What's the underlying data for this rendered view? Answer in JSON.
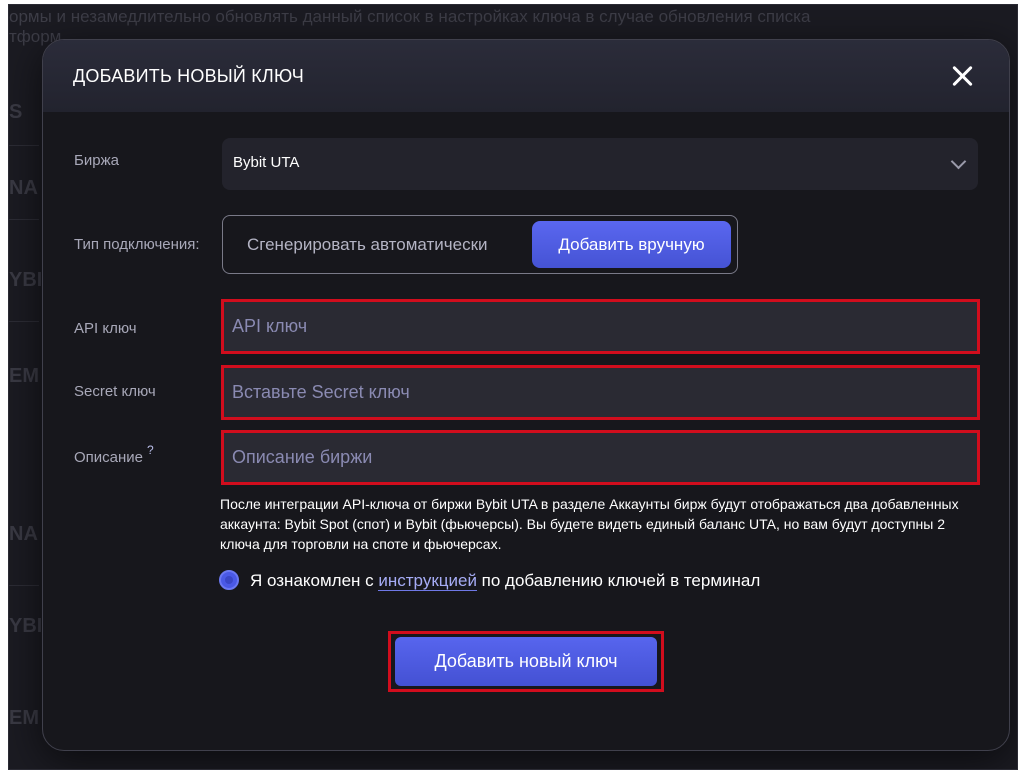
{
  "background": {
    "top_text_line1": "ормы и незамедлительно обновлять данный список в настройках ключа в случае обновления списка",
    "top_text_line2": "тформ",
    "side_labels": [
      "S",
      "NA",
      "YBI",
      "EM",
      "NA",
      "YBI",
      "EM"
    ]
  },
  "modal": {
    "title": "ДОБАВИТЬ НОВЫЙ КЛЮЧ",
    "close_icon": "close-icon"
  },
  "exchange": {
    "label": "Биржа",
    "selected": "Bybit UTA",
    "chevron_icon": "chevron-down-icon"
  },
  "connection_type": {
    "label": "Тип подключения:",
    "options": [
      "Сгенерировать автоматически",
      "Добавить вручную"
    ],
    "selected": "Добавить вручную"
  },
  "api_key": {
    "label": "API ключ",
    "value": "",
    "placeholder": "API ключ"
  },
  "secret_key": {
    "label": "Secret ключ",
    "value": "",
    "placeholder": "Вставьте Secret ключ"
  },
  "description": {
    "label": "Описание",
    "help_mark": "?",
    "value": "",
    "placeholder": "Описание биржи"
  },
  "info_text": "После интеграции API-ключа от биржи Bybit UTA в разделе Аккаунты бирж будут отображаться два добавленных аккаунта: Bybit Spot (спот) и Bybit (фьючерсы). Вы будете видеть единый баланс UTA, но вам будут доступны 2 ключа для торговли на споте и фьючерсах.",
  "agreement": {
    "checked": true,
    "text_before": "Я ознакомлен с ",
    "link_text": "инструкцией",
    "text_after": " по добавлению ключей в терминал"
  },
  "submit_label": "Добавить новый ключ",
  "colors": {
    "accent": "#4a59e6",
    "highlight_border": "#d10d1d",
    "modal_bg": "#17171c",
    "field_bg": "#2a2a33"
  }
}
